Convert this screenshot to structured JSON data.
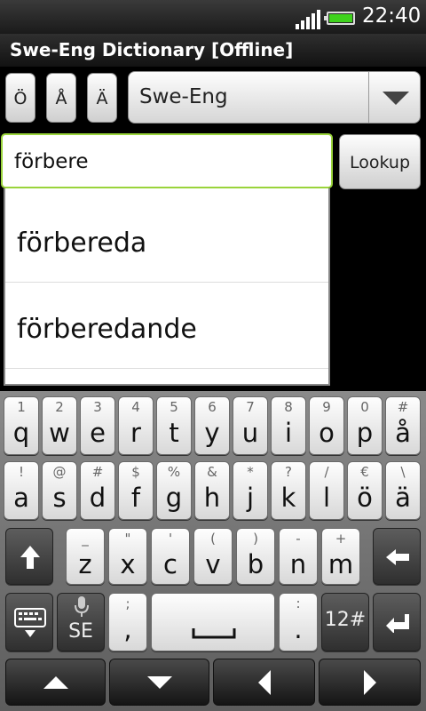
{
  "status": {
    "time": "22:40"
  },
  "app": {
    "title": "Swe-Eng Dictionary [Offline]"
  },
  "special_chars": [
    "Ö",
    "Å",
    "Ä"
  ],
  "language": {
    "selected": "Swe-Eng"
  },
  "search": {
    "value": "förbere"
  },
  "lookup_label": "Lookup",
  "suggestions": [
    "förbereda",
    "förberedande"
  ],
  "keyboard": {
    "row1": [
      {
        "main": "q",
        "sec": "1"
      },
      {
        "main": "w",
        "sec": "2"
      },
      {
        "main": "e",
        "sec": "3"
      },
      {
        "main": "r",
        "sec": "4"
      },
      {
        "main": "t",
        "sec": "5"
      },
      {
        "main": "y",
        "sec": "6"
      },
      {
        "main": "u",
        "sec": "7"
      },
      {
        "main": "i",
        "sec": "8"
      },
      {
        "main": "o",
        "sec": "9"
      },
      {
        "main": "p",
        "sec": "0"
      },
      {
        "main": "å",
        "sec": "#"
      }
    ],
    "row2": [
      {
        "main": "a",
        "sec": "!"
      },
      {
        "main": "s",
        "sec": "@"
      },
      {
        "main": "d",
        "sec": "#"
      },
      {
        "main": "f",
        "sec": "$"
      },
      {
        "main": "g",
        "sec": "%"
      },
      {
        "main": "h",
        "sec": "&"
      },
      {
        "main": "j",
        "sec": "*"
      },
      {
        "main": "k",
        "sec": "?"
      },
      {
        "main": "l",
        "sec": "/"
      },
      {
        "main": "ö",
        "sec": "€"
      },
      {
        "main": "ä",
        "sec": "\\"
      }
    ],
    "row3": [
      {
        "main": "z",
        "sec": "_"
      },
      {
        "main": "x",
        "sec": "\""
      },
      {
        "main": "c",
        "sec": "'"
      },
      {
        "main": "v",
        "sec": "("
      },
      {
        "main": "b",
        "sec": ")"
      },
      {
        "main": "n",
        "sec": "-"
      },
      {
        "main": "m",
        "sec": "+"
      }
    ],
    "row4": {
      "lang_label": "SE",
      "comma": {
        "main": ",",
        "sec": ";"
      },
      "period": {
        "main": ".",
        "sec": ":"
      },
      "symbols_label": "12#"
    }
  }
}
